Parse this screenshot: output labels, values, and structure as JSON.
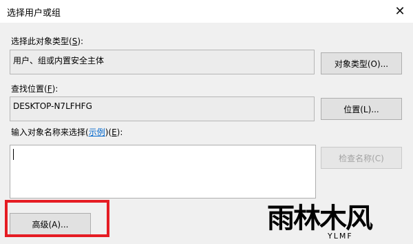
{
  "window": {
    "title": "选择用户或组",
    "close_glyph": "✕"
  },
  "object_type": {
    "label_prefix": "选择此对象类型(",
    "label_key": "S",
    "label_suffix": "):",
    "value": "用户、组或内置安全主体",
    "button_label": "对象类型(O)..."
  },
  "location": {
    "label_prefix": "查找位置(",
    "label_key": "F",
    "label_suffix": "):",
    "value": "DESKTOP-N7LFHFG",
    "button_label": "位置(L)..."
  },
  "object_names": {
    "label_prefix": "输入对象名称来选择(",
    "label_link": "示例",
    "label_mid": ")(",
    "label_key": "E",
    "label_suffix": "):",
    "value": "",
    "check_button_label": "检查名称(C)"
  },
  "advanced_button_label": "高级(A)...",
  "watermark": {
    "main": "雨林木风",
    "sub": "YLMF"
  },
  "colors": {
    "highlight": "#e51c23",
    "link": "#0066cc",
    "background": "#f0f0f0"
  }
}
